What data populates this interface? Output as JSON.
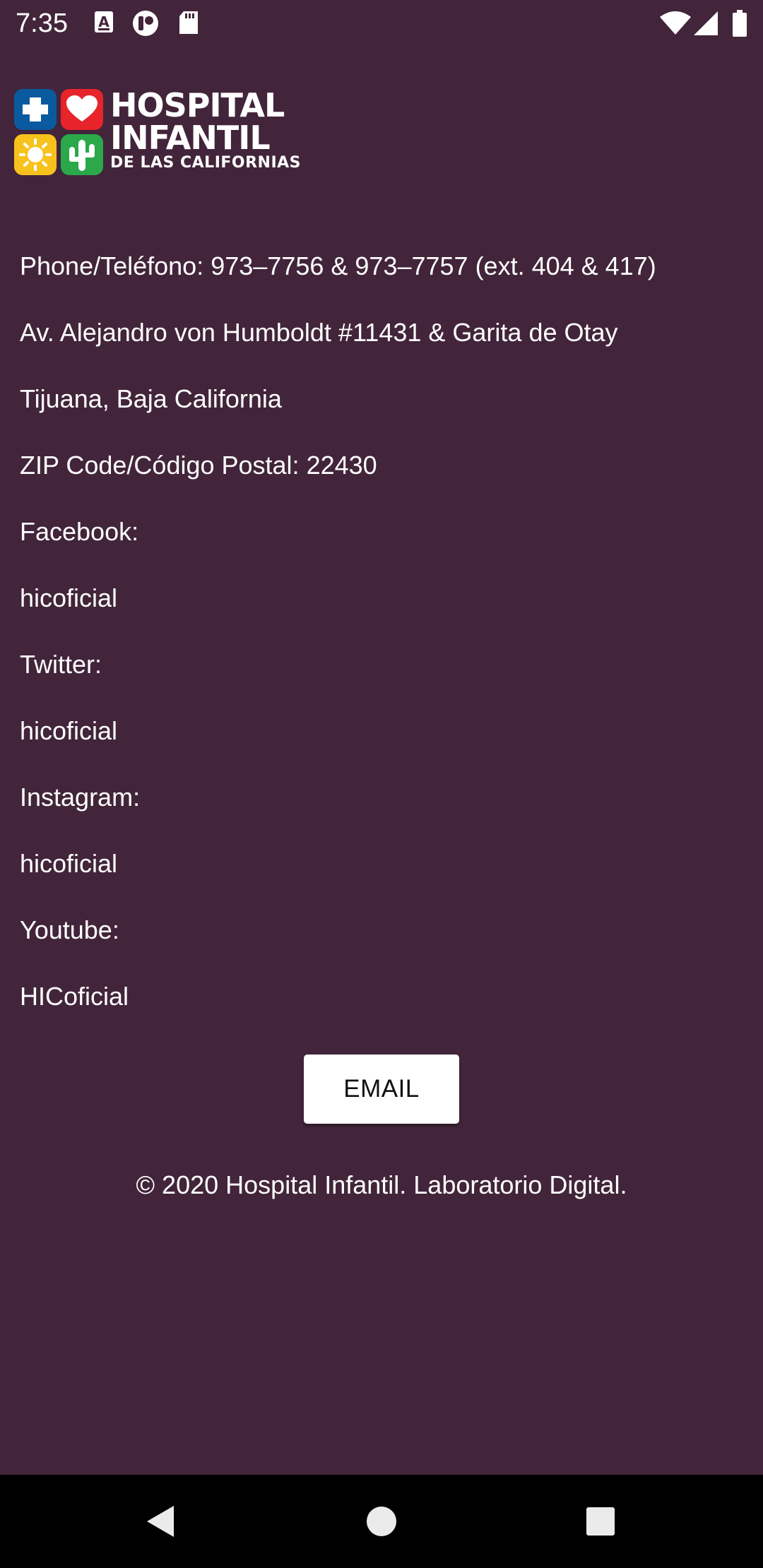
{
  "status_bar": {
    "time": "7:35",
    "left_icons": [
      "keyboard-a-icon",
      "notification-app-icon",
      "sd-card-icon"
    ],
    "right_icons": [
      "wifi-icon",
      "signal-icon",
      "battery-icon"
    ]
  },
  "logo": {
    "line1": "HOSPITAL",
    "line2": "INFANTIL",
    "line3": "DE LAS CALIFORNIAS",
    "tile_colors": {
      "cross": "#0a5aa0",
      "heart": "#e8242b",
      "sun": "#f7c21b",
      "cactus": "#2aa84a"
    }
  },
  "info": {
    "phone": "Phone/Teléfono: 973–7756 & 973–7757 (ext. 404 & 417)",
    "address": "Av. Alejandro von Humboldt #11431 & Garita de Otay",
    "city": "Tijuana, Baja California",
    "zip": "ZIP Code/Código Postal: 22430",
    "facebook_label": "Facebook:",
    "facebook_value": "hicoficial",
    "twitter_label": "Twitter:",
    "twitter_value": "hicoficial",
    "instagram_label": "Instagram:",
    "instagram_value": "hicoficial",
    "youtube_label": "Youtube:",
    "youtube_value": "HICoficial"
  },
  "email_button_label": "EMAIL",
  "footer": "© 2020 Hospital Infantil. Laboratorio Digital.",
  "colors": {
    "background": "#42253a",
    "nav_bar": "#000000"
  }
}
